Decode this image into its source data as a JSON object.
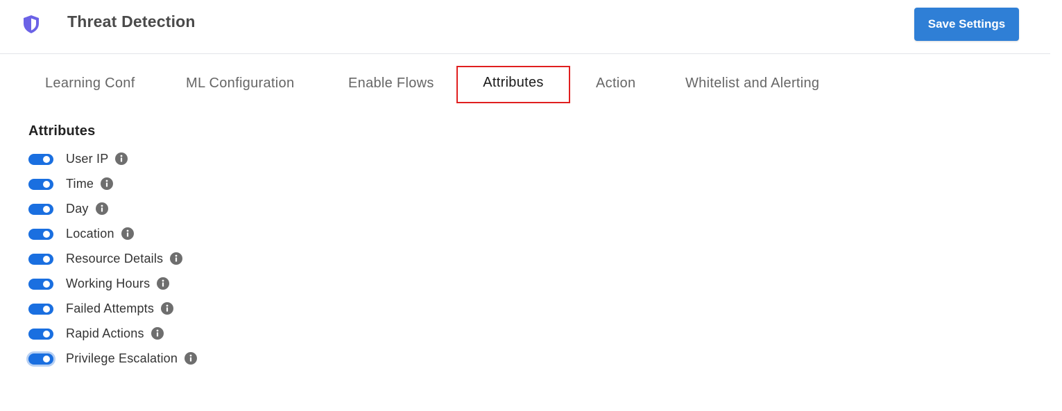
{
  "header": {
    "title": "Threat Detection",
    "logo_icon": "shield-icon",
    "save_label": "Save Settings",
    "accent_color": "#2f7fd6"
  },
  "tabs": [
    {
      "label": "Learning Conf",
      "active": false
    },
    {
      "label": "ML Configuration",
      "active": false
    },
    {
      "label": "Enable Flows",
      "active": false
    },
    {
      "label": "Attributes",
      "active": true
    },
    {
      "label": "Action",
      "active": false
    },
    {
      "label": "Whitelist and Alerting",
      "active": false
    }
  ],
  "attributes": {
    "title": "Attributes",
    "toggle_color": "#1a6fe0",
    "info_icon": "info-icon",
    "items": [
      {
        "label": "User IP",
        "enabled": true
      },
      {
        "label": "Time",
        "enabled": true
      },
      {
        "label": "Day",
        "enabled": true
      },
      {
        "label": "Location",
        "enabled": true
      },
      {
        "label": "Resource Details",
        "enabled": true
      },
      {
        "label": "Working Hours",
        "enabled": true
      },
      {
        "label": "Failed Attempts",
        "enabled": true
      },
      {
        "label": "Rapid Actions",
        "enabled": true
      },
      {
        "label": "Privilege Escalation",
        "enabled": true
      }
    ]
  }
}
